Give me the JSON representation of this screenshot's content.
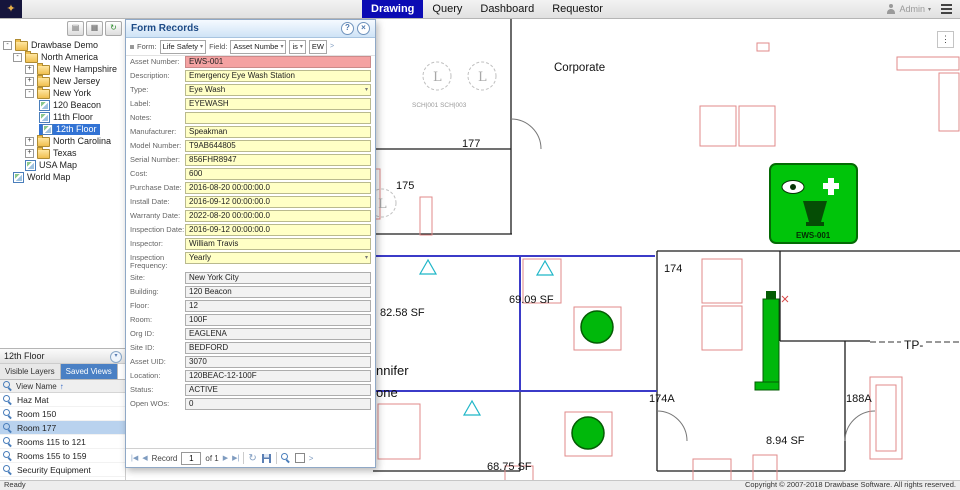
{
  "topbar": {
    "tabs": [
      {
        "label": "Drawing"
      },
      {
        "label": "Query"
      },
      {
        "label": "Dashboard"
      },
      {
        "label": "Requestor"
      }
    ],
    "user": "Admin"
  },
  "icons": {
    "logo": "✦",
    "help": "?",
    "close": "×",
    "dropdown": "▾",
    "sort_asc": "↑",
    "panel_collapse": "▾",
    "dots_menu": "⋮",
    "nav_first": "|◀",
    "nav_prev": "◀",
    "nav_next": "▶",
    "nav_last": "▶|",
    "refresh": "↻",
    "chevron_right": ">",
    "toolbar_layers": "▤",
    "toolbar_grid": "▦",
    "toolbar_refresh": "↻"
  },
  "sidebar": {
    "tree": {
      "items": [
        {
          "label": "Drawbase Demo",
          "toggle": "-"
        },
        {
          "label": "North America",
          "toggle": "-"
        },
        {
          "label": "New Hampshire",
          "toggle": "+"
        },
        {
          "label": "New Jersey",
          "toggle": "+"
        },
        {
          "label": "New York",
          "toggle": "-"
        },
        {
          "label": "120 Beacon"
        },
        {
          "label": "11th Floor"
        },
        {
          "label": "12th Floor"
        },
        {
          "label": "North Carolina",
          "toggle": "+"
        },
        {
          "label": "Texas",
          "toggle": "+"
        },
        {
          "label": "USA Map"
        },
        {
          "label": "World Map"
        }
      ]
    }
  },
  "views_panel": {
    "title": "12th Floor",
    "tabs": [
      {
        "label": "Visible Layers"
      },
      {
        "label": "Saved Views"
      }
    ],
    "column_header": "View Name",
    "rows": [
      "Haz Mat",
      "Room 150",
      "Room 177",
      "Rooms 115 to 121",
      "Rooms 155 to 159",
      "Security Equipment"
    ]
  },
  "form_records": {
    "title": "Form Records",
    "filter": {
      "form_label": "Form:",
      "form_value": "Life Safety",
      "field_label": "Field:",
      "field_value": "Asset Numbe",
      "operator": "is",
      "value": "EW"
    },
    "fields": [
      {
        "label": "Asset Number:",
        "value": "EWS-001"
      },
      {
        "label": "Description:",
        "value": "Emergency Eye Wash Station"
      },
      {
        "label": "Type:",
        "value": "Eye Wash"
      },
      {
        "label": "Label:",
        "value": "EYEWASH"
      },
      {
        "label": "Notes:",
        "value": ""
      },
      {
        "label": "Manufacturer:",
        "value": "Speakman"
      },
      {
        "label": "Model Number:",
        "value": "T9AB644805"
      },
      {
        "label": "Serial Number:",
        "value": "856FHR8947"
      },
      {
        "label": "Cost:",
        "value": "600"
      },
      {
        "label": "Purchase Date:",
        "value": "2016-08-20 00:00:00.0"
      },
      {
        "label": "Install Date:",
        "value": "2016-09-12 00:00:00.0"
      },
      {
        "label": "Warranty Date:",
        "value": "2022-08-20 00:00:00.0"
      },
      {
        "label": "Inspection Date:",
        "value": "2016-09-12 00:00:00.0"
      },
      {
        "label": "Inspector:",
        "value": "William Travis"
      },
      {
        "label": "Inspection Frequency:",
        "value": "Yearly"
      },
      {
        "label": "Site:",
        "value": "New York City"
      },
      {
        "label": "Building:",
        "value": "120 Beacon"
      },
      {
        "label": "Floor:",
        "value": "12"
      },
      {
        "label": "Room:",
        "value": "100F"
      },
      {
        "label": "Org ID:",
        "value": "EAGLENA"
      },
      {
        "label": "Site ID:",
        "value": "BEDFORD"
      },
      {
        "label": "Asset UID:",
        "value": "3070"
      },
      {
        "label": "Location:",
        "value": "120BEAC-12-100F"
      },
      {
        "label": "Status:",
        "value": "ACTIVE"
      },
      {
        "label": "Open WOs:",
        "value": "0"
      }
    ],
    "nav": {
      "record_label": "Record",
      "record_value": "1",
      "of_label": "of 1"
    }
  },
  "drawing": {
    "ews_label": "EWS-001",
    "labels": [
      {
        "text": "Corporate"
      },
      {
        "text": "177"
      },
      {
        "text": "SCH|001 SCH|003"
      },
      {
        "text": "175"
      },
      {
        "text": "174"
      },
      {
        "text": "69.09 SF"
      },
      {
        "text": "82.58 SF"
      },
      {
        "text": "nnifer"
      },
      {
        "text": "one"
      },
      {
        "text": "174A"
      },
      {
        "text": "188A"
      },
      {
        "text": "8.94 SF"
      },
      {
        "text": "68.75 SF"
      },
      {
        "text": "TP-"
      },
      {
        "text": "L"
      },
      {
        "text": "L"
      },
      {
        "text": "L"
      }
    ]
  },
  "statusbar": {
    "left": "Ready",
    "right": "Copyright © 2007-2018 Drawbase Software. All rights reserved."
  }
}
